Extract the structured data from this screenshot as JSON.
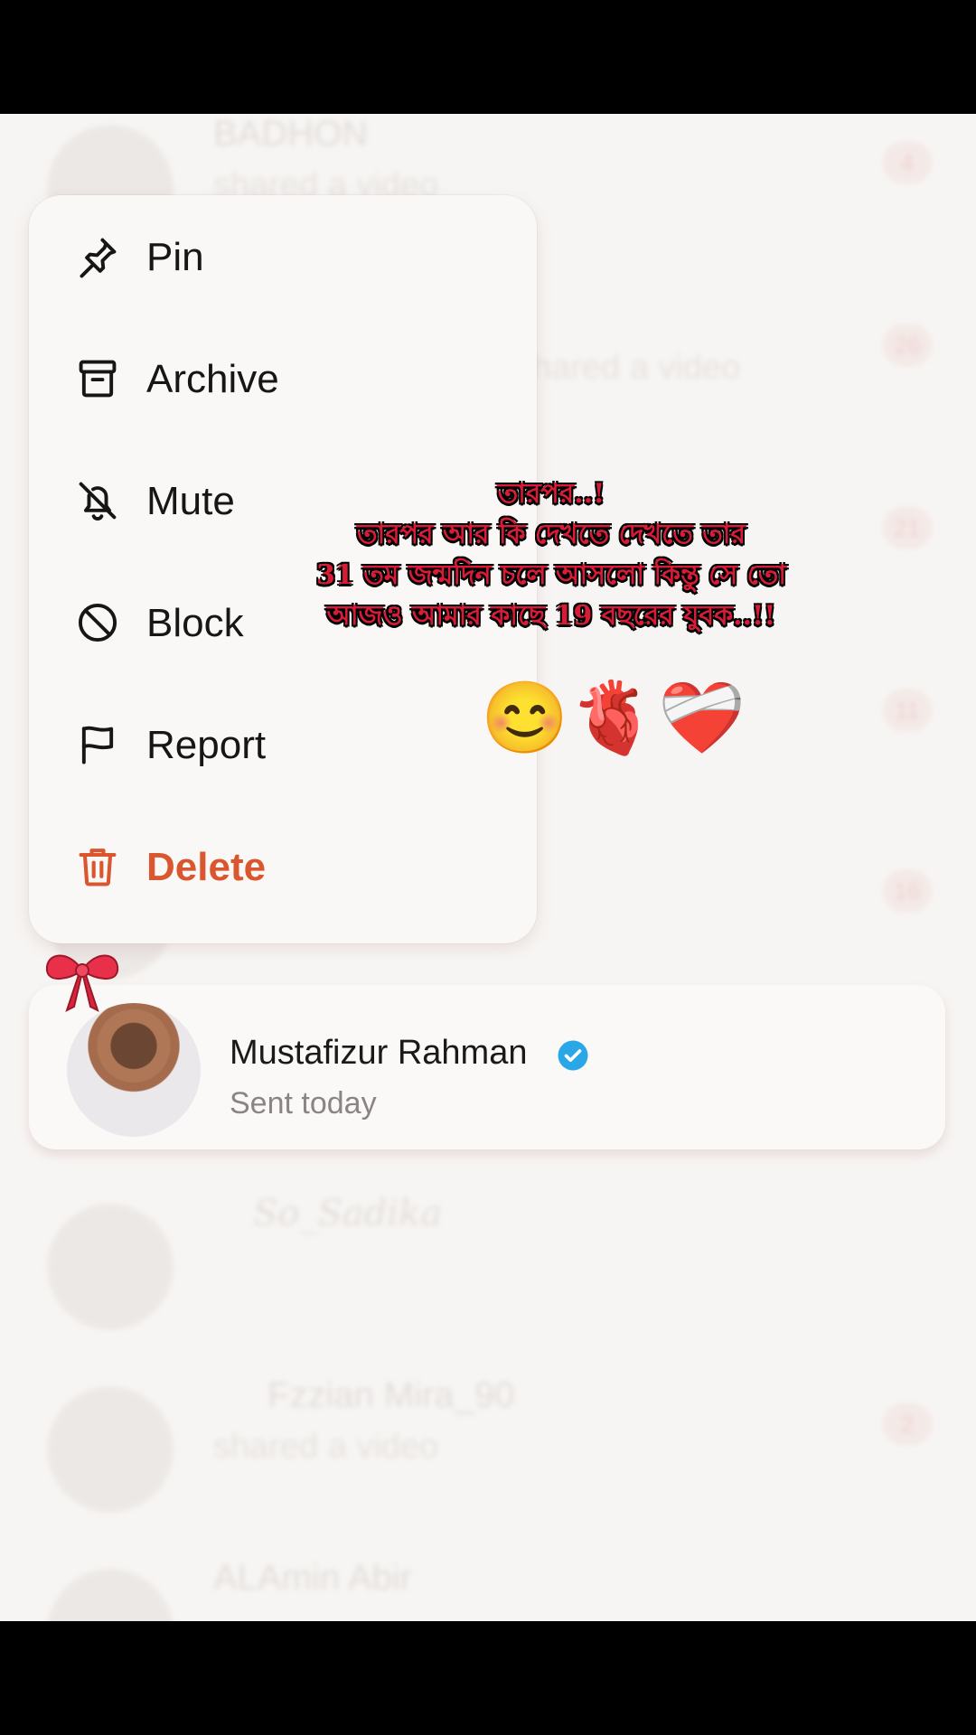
{
  "background_list": [
    {
      "name": "BADHON",
      "sub": "shared a video",
      "badge": "4"
    },
    {
      "name": "",
      "sub": "shared a video",
      "badge": "26"
    },
    {
      "name": "",
      "sub": "",
      "badge": "21"
    },
    {
      "name": "",
      "sub": "",
      "badge": "11"
    },
    {
      "name": "",
      "sub": "",
      "badge": "16"
    },
    {
      "name": "So_Sadika",
      "sub": "",
      "badge": ""
    },
    {
      "name": "Fzzian Mira_90",
      "sub": "shared a video",
      "badge": "2"
    },
    {
      "name": "ALAmin Abir",
      "sub": "",
      "badge": ""
    }
  ],
  "menu": {
    "items": [
      {
        "label": "Pin",
        "icon": "pin-icon"
      },
      {
        "label": "Archive",
        "icon": "archive-icon"
      },
      {
        "label": "Mute",
        "icon": "bell-off-icon"
      },
      {
        "label": "Block",
        "icon": "block-icon"
      },
      {
        "label": "Report",
        "icon": "flag-icon"
      },
      {
        "label": "Delete",
        "icon": "trash-icon"
      }
    ]
  },
  "chat": {
    "name": "Mustafizur Rahman",
    "verified": true,
    "subtitle": "Sent today"
  },
  "overlay": {
    "lines": [
      "তারপর..!",
      "তারপর আর কি দেখতে দেখতে তার",
      "31 তম জন্মদিন চলে আসলো কিন্তু সে তো",
      "আজও আমার কাছে 19 বছরের যুবক..!!"
    ],
    "emojis": [
      "😊",
      "🫀",
      "❤️‍🩹"
    ]
  },
  "colors": {
    "danger": "#d9562e",
    "verified": "#2aa7e6",
    "caption": "#d81b36"
  }
}
